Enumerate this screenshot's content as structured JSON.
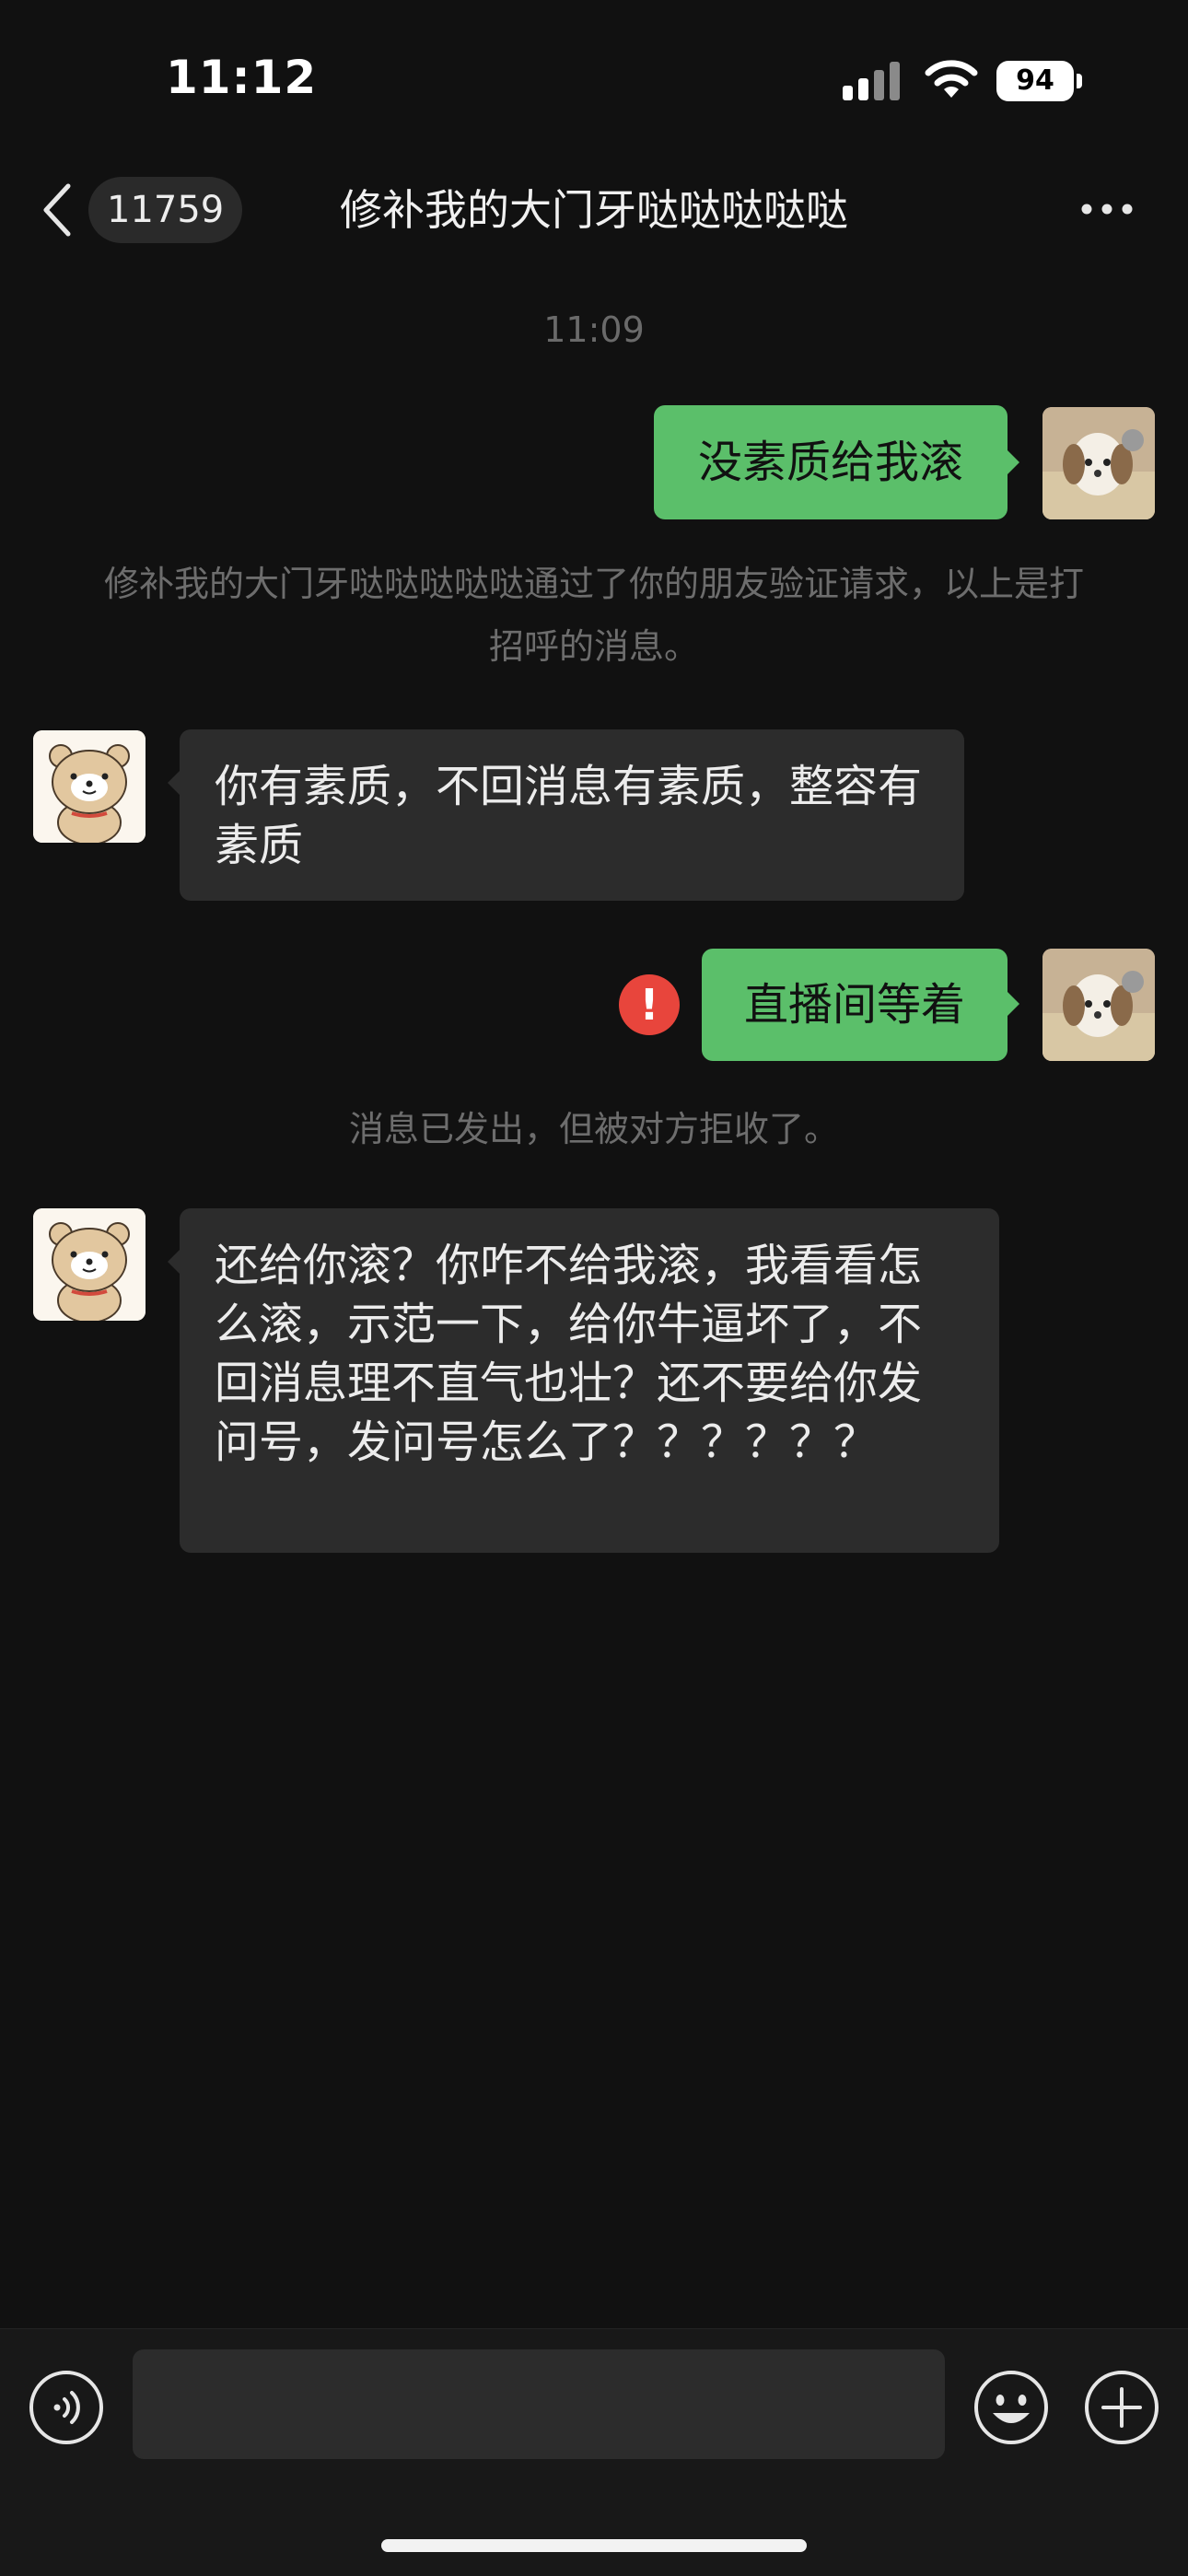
{
  "status_bar": {
    "time": "11:12",
    "battery": "94"
  },
  "header": {
    "unread_count": "11759",
    "title": "修补我的大门牙哒哒哒哒哒"
  },
  "chat": {
    "timestamp": "11:09",
    "messages": [
      {
        "side": "out",
        "text": "没素质给我滚"
      },
      {
        "side": "system",
        "text": "修补我的大门牙哒哒哒哒哒通过了你的朋友验证请求，以上是打招呼的消息。"
      },
      {
        "side": "in",
        "text": "你有素质，不回消息有素质，整容有素质"
      },
      {
        "side": "out",
        "text": "直播间等着",
        "status": "failed"
      },
      {
        "side": "system",
        "text": "消息已发出，但被对方拒收了。"
      },
      {
        "side": "in",
        "text": "还给你滚？你咋不给我滚，我看看怎么滚，示范一下，给你牛逼坏了，不回消息理不直气也壮？还不要给你发问号，发问号怎么了？？？？？？"
      }
    ]
  },
  "input_bar": {
    "placeholder": "",
    "voice_icon": "voice-icon",
    "emoji_icon": "emoji-icon",
    "add_icon": "plus-icon"
  },
  "colors": {
    "background": "#111111",
    "outgoing_bubble": "#5bbf6a",
    "incoming_bubble": "#2c2c2c",
    "error": "#e8453c"
  }
}
